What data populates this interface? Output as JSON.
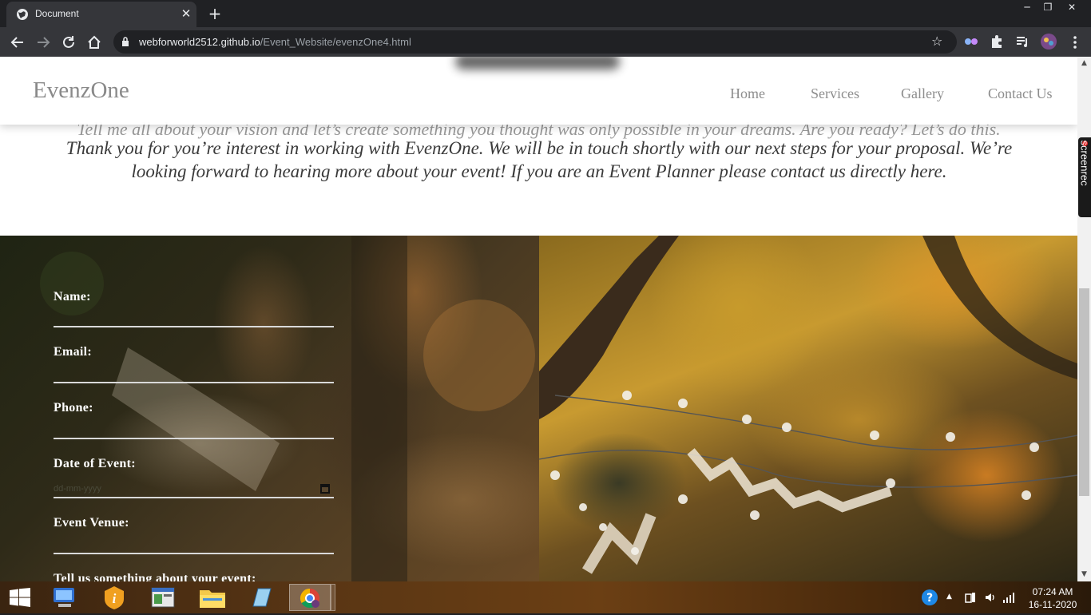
{
  "browser": {
    "tab_title": "Document",
    "url_host": "webforworld2512.github.io",
    "url_path": "/Event_Website/evenzOne4.html"
  },
  "page": {
    "brand": "EvenzOne",
    "nav": [
      "Home",
      "Services",
      "Gallery",
      "Contact Us"
    ],
    "intro_hidden": "Tell me all about your vision and let’s create something you thought was only possible in your dreams. Are you ready? Let’s do this.",
    "intro": "Thank you for you’re interest in working with EvenzOne. We will be in touch shortly with our next steps for your proposal. We’re looking forward to hearing more about your event! If you are an Event Planner please contact us directly here.",
    "form": {
      "name_label": "Name:",
      "email_label": "Email:",
      "phone_label": "Phone:",
      "date_label": "Date of Event:",
      "date_placeholder": "dd-mm-yyyy",
      "venue_label": "Event Venue:",
      "message_label": "Tell us something about your event:"
    }
  },
  "extensions": {
    "screenrec_label": "screenrec"
  },
  "taskbar": {
    "time": "07:24 AM",
    "date": "16-11-2020"
  }
}
